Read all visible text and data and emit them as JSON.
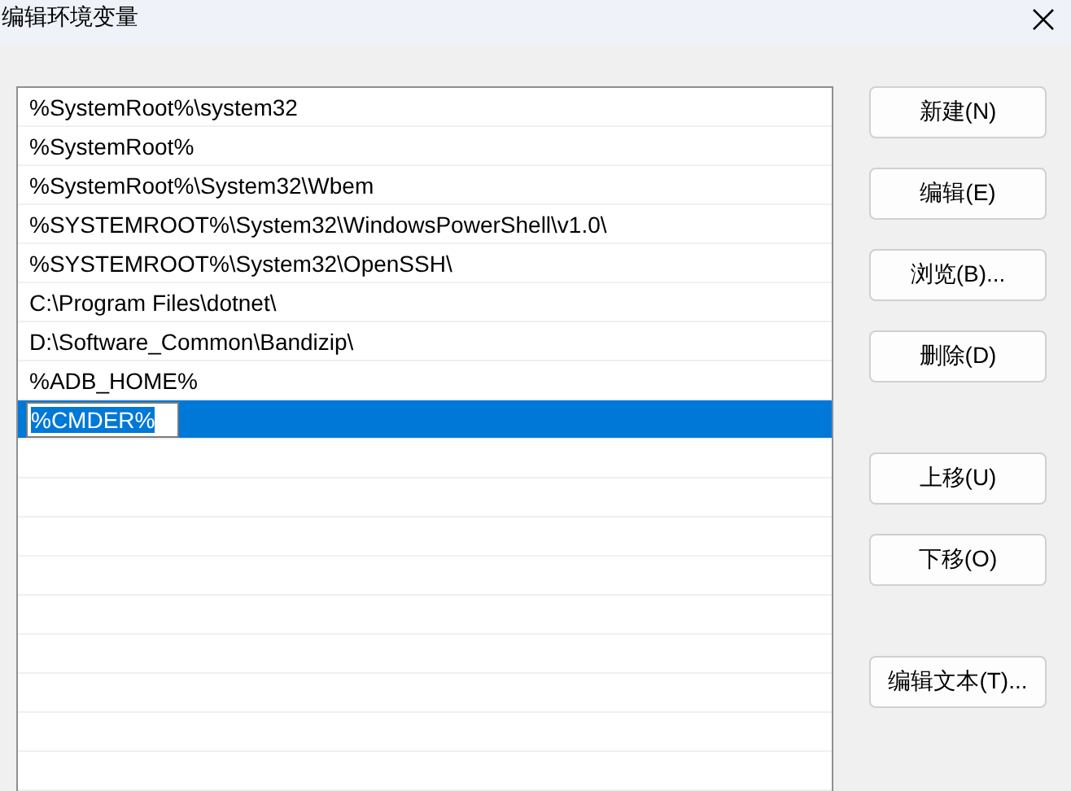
{
  "window": {
    "title": "编辑环境变量"
  },
  "paths": [
    {
      "text": "%SystemRoot%\\system32",
      "selected": false
    },
    {
      "text": "%SystemRoot%",
      "selected": false
    },
    {
      "text": "%SystemRoot%\\System32\\Wbem",
      "selected": false
    },
    {
      "text": "%SYSTEMROOT%\\System32\\WindowsPowerShell\\v1.0\\",
      "selected": false
    },
    {
      "text": "%SYSTEMROOT%\\System32\\OpenSSH\\",
      "selected": false
    },
    {
      "text": "C:\\Program Files\\dotnet\\",
      "selected": false
    },
    {
      "text": "D:\\Software_Common\\Bandizip\\",
      "selected": false
    },
    {
      "text": "%ADB_HOME%",
      "selected": false
    },
    {
      "text": "%CMDER%",
      "selected": true
    }
  ],
  "button_groups": [
    [
      "新建(N)",
      "编辑(E)",
      "浏览(B)...",
      "删除(D)"
    ],
    [
      "上移(U)",
      "下移(O)"
    ],
    [
      "编辑文本(T)..."
    ]
  ]
}
